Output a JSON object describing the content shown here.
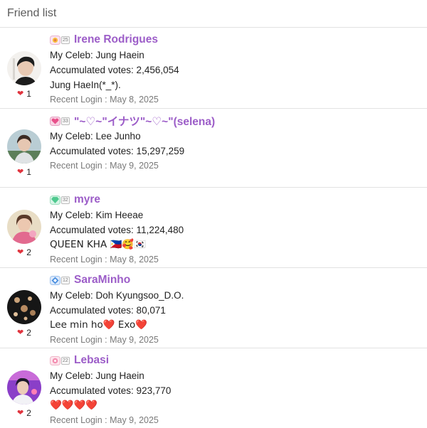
{
  "title": "Friend list",
  "friends": [
    {
      "level": "25",
      "name": "Irene Rodrigues",
      "celeb": "My Celeb: Jung Haein",
      "votes": "Accumulated votes: 2,456,054",
      "message": " Jung HaeIn(*_*).",
      "login": "Recent Login : May 8, 2025",
      "likes": "1"
    },
    {
      "level": "33",
      "name": "\"~♡~\"イナツ\"~♡~\"(selena)",
      "celeb": "My Celeb: Lee Junho",
      "votes": "Accumulated votes: 15,297,259",
      "message": "",
      "login": "Recent Login : May 9, 2025",
      "likes": "1"
    },
    {
      "level": "32",
      "name": "myre",
      "celeb": "My Celeb: Kim Heeae",
      "votes": "Accumulated votes: 11,224,480",
      "message": "QUEEN KHA 🇵🇭🥰🇰🇷",
      "login": "Recent Login : May 8, 2025",
      "likes": "2"
    },
    {
      "level": "12",
      "name": "SaraMinho",
      "celeb": "My Celeb: Doh Kyungsoo_D.O.",
      "votes": "Accumulated votes: 80,071",
      "message": "Lee min ho❤️ Exo❤️",
      "login": "Recent Login : May 9, 2025",
      "likes": "2"
    },
    {
      "level": "22",
      "name": "Lebasi",
      "celeb": "My Celeb: Jung Haein",
      "votes": "Accumulated votes: 923,770",
      "message": "❤️❤️❤️❤️",
      "login": "Recent Login : May 9, 2025",
      "likes": "2"
    }
  ]
}
